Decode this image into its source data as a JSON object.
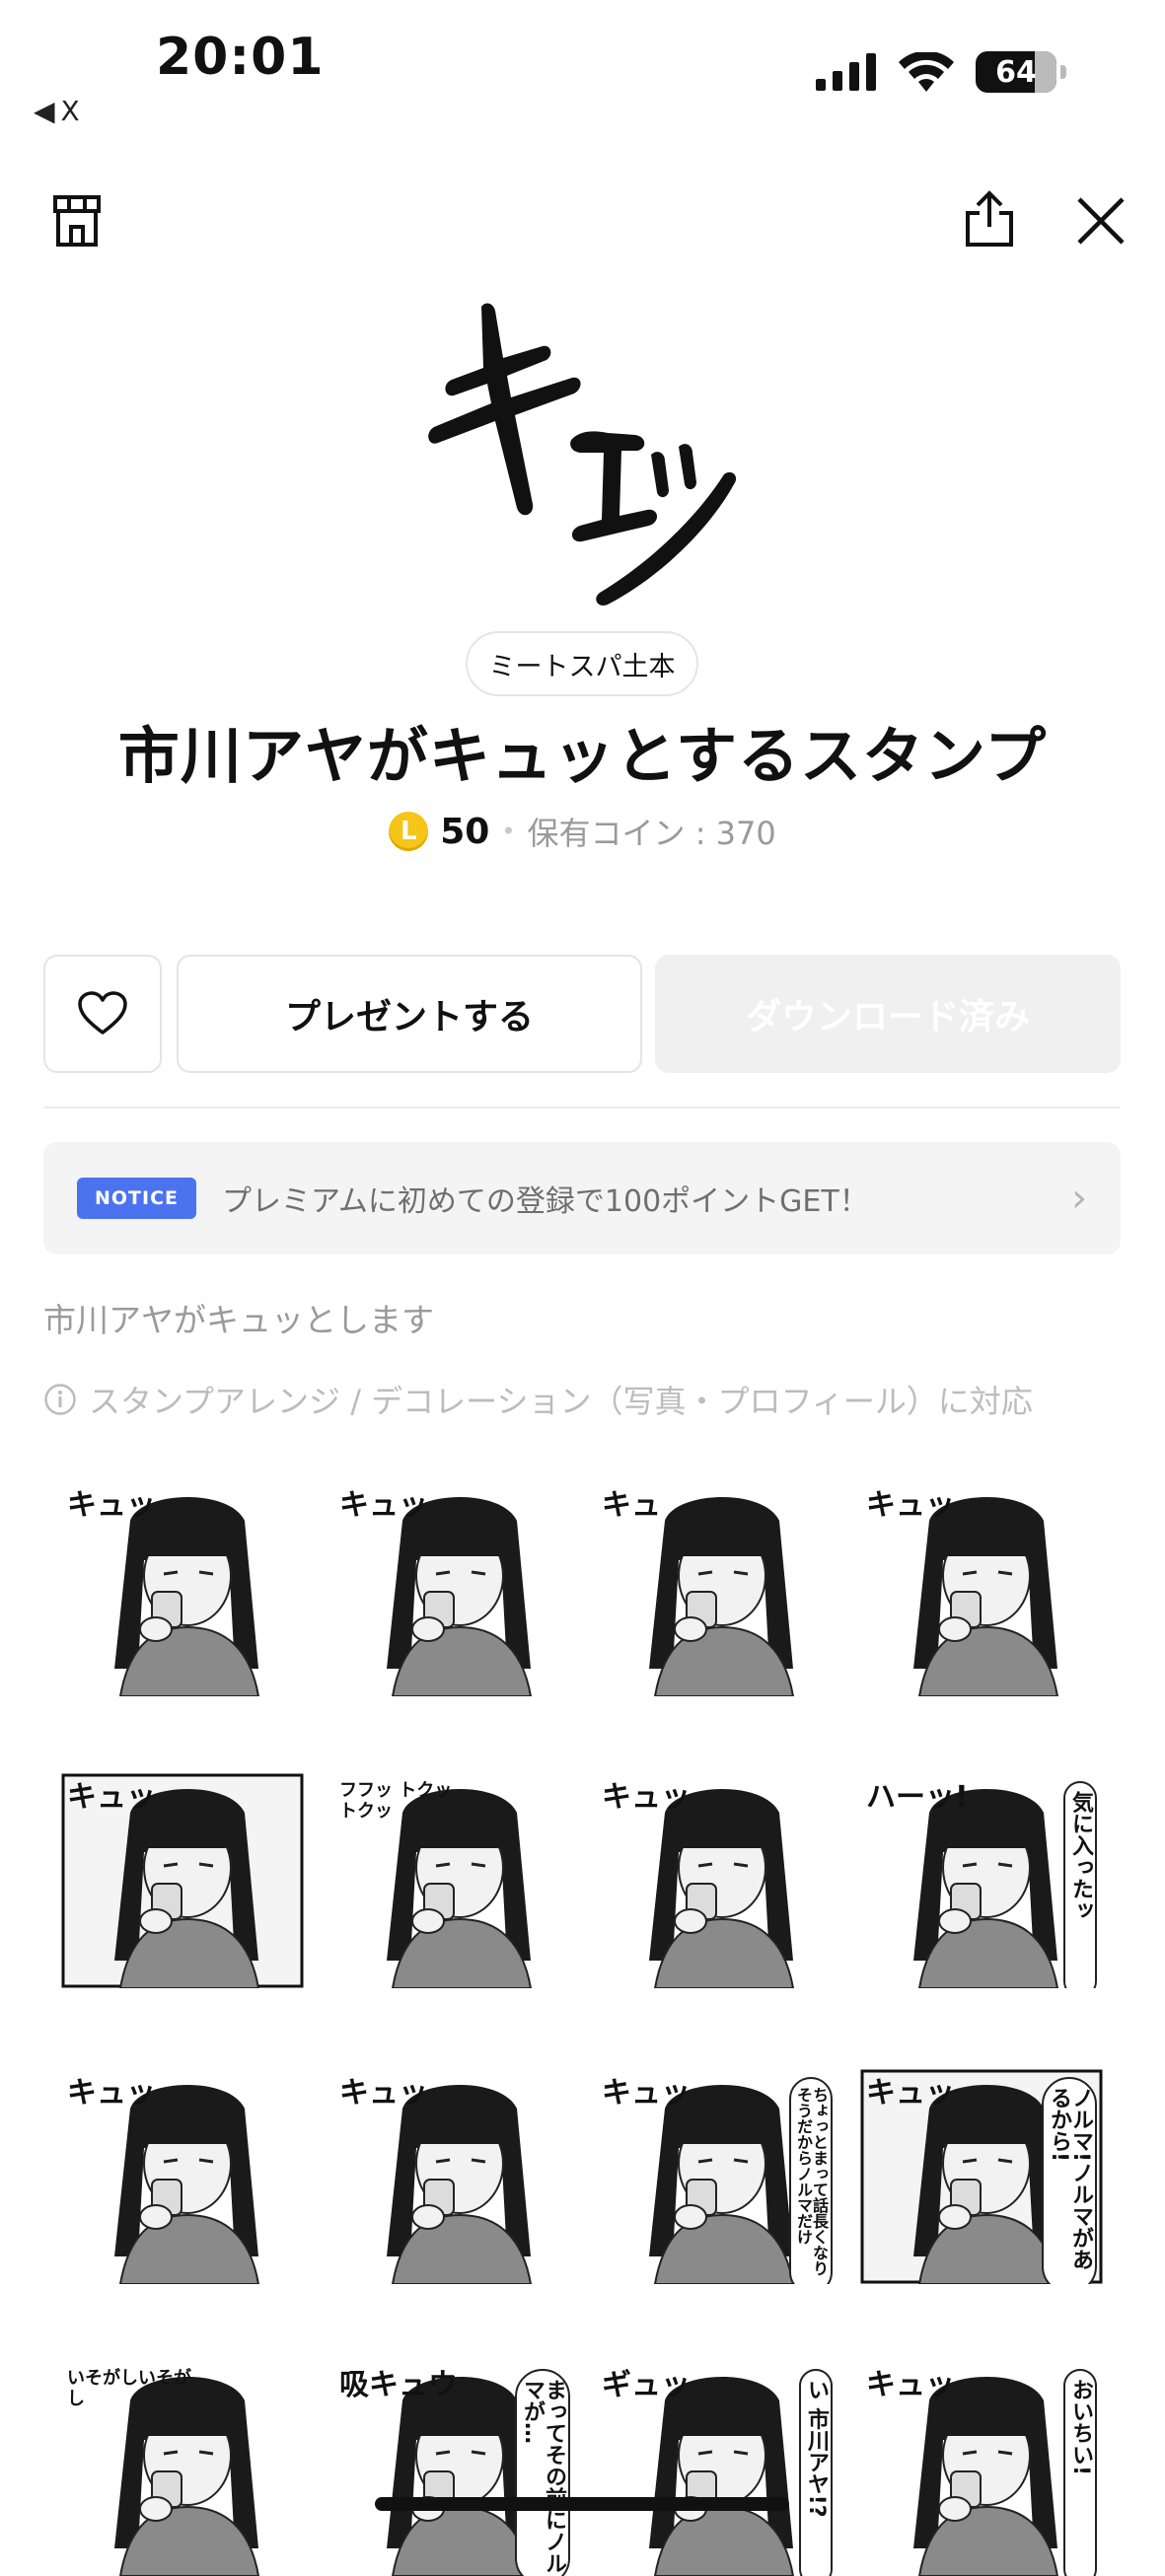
{
  "status_bar": {
    "time": "20:01",
    "back_label": "X",
    "battery": "64"
  },
  "header": {
    "shop_icon": "shop-icon",
    "share_icon": "share-icon",
    "close_icon": "close-icon"
  },
  "product": {
    "sticker_text": "キュッ",
    "author": "ミートスパ土本",
    "title": "市川アヤがキュッとするスタンプ",
    "coin_symbol": "L",
    "price": "50",
    "separator": "•",
    "owned_coins": "保有コイン : 370"
  },
  "actions": {
    "gift_label": "プレゼントする",
    "download_label": "ダウンロード済み"
  },
  "notice": {
    "badge": "NOTICE",
    "text": "プレミアムに初めての登録で100ポイントGET！",
    "chevron": "›"
  },
  "description": "市川アヤがキュッとします",
  "feature": "スタンプアレンジ / デコレーション（写真・プロフィール）に対応",
  "stickers": [
    {
      "text": "キュッ"
    },
    {
      "text": "キュッ"
    },
    {
      "text": "キュ"
    },
    {
      "text": "キュッ"
    },
    {
      "text": "キュッ"
    },
    {
      "text": "フフッ トクットクッ"
    },
    {
      "text": "キュッ"
    },
    {
      "text": "ハーッ!",
      "text2": "気に入ったッ"
    },
    {
      "text": "キュッ"
    },
    {
      "text": "キュッ"
    },
    {
      "text": "キュッ",
      "text2": "ちょっとまって話長くなりそうだからノルマだけ"
    },
    {
      "text": "キュッ",
      "text2": "ノルマ!ノルマがあるから!"
    },
    {
      "text": "いそがしいそがし"
    },
    {
      "text": "吸キュウ",
      "text2": "まってその前にノルマが…"
    },
    {
      "text": "ギュッ",
      "text2": "い 市川アヤ!?"
    },
    {
      "text": "キュッ",
      "text2": "おいちい!"
    }
  ],
  "colors": {
    "accent_blue": "#4b73f0",
    "coin_yellow": "#f5c518",
    "muted_gray": "#9a9a9a"
  }
}
